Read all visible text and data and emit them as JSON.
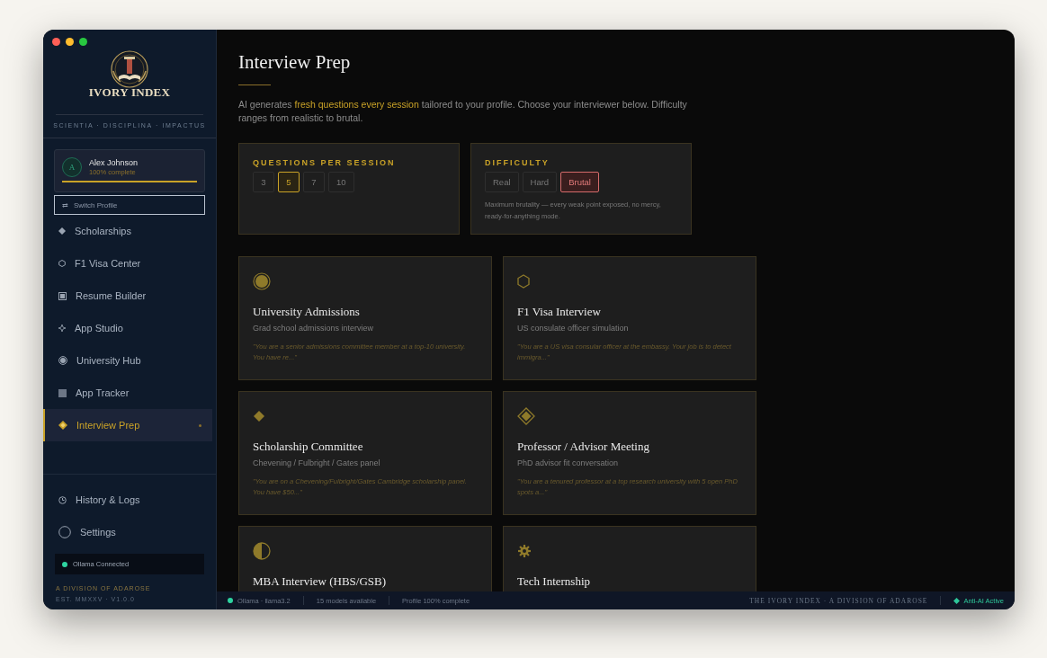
{
  "sidebar": {
    "logo_text": "IVORY INDEX",
    "motto": "SCIENTIA · DISCIPLINA · IMPACTUS",
    "profile": {
      "initial": "A",
      "name": "Alex Johnson",
      "progress_text": "100% complete",
      "level": 1
    },
    "switch_button": {
      "icon": "⇄",
      "label": "Switch Profile"
    },
    "nav_items": [
      {
        "label": "Scholarships",
        "selected": false
      },
      {
        "label": "F1 Visa Center",
        "selected": false
      },
      {
        "label": "Resume Builder",
        "selected": false
      },
      {
        "label": "App Studio",
        "selected": false
      },
      {
        "label": "University Hub",
        "selected": false
      },
      {
        "label": "App Tracker",
        "selected": false
      },
      {
        "label": "Interview Prep",
        "selected": true
      }
    ],
    "footer_items": [
      {
        "label": "History & Logs"
      },
      {
        "label": "Settings"
      }
    ],
    "connection": {
      "label": "Ollama Connected",
      "connected": true
    },
    "division": "A DIVISION OF ADAROSE",
    "version": "EST. MMXXV · V1.0.0"
  },
  "main": {
    "title": "Interview Prep",
    "intro": "AI generates **fresh questions every session** tailored to your profile. Choose your interviewer below. Difficulty ranges from realistic to brutal.",
    "questions": {
      "label": "QUESTIONS PER SESSION",
      "options": [
        {
          "label": "3",
          "selected": false
        },
        {
          "label": "5",
          "selected": true
        },
        {
          "label": "7",
          "selected": false
        },
        {
          "label": "10",
          "selected": false
        }
      ]
    },
    "difficulty": {
      "label": "DIFFICULTY",
      "options": [
        {
          "label": "Real",
          "selected": false
        },
        {
          "label": "Hard",
          "selected": false
        },
        {
          "label": "Brutal",
          "selected": true
        }
      ],
      "description": "Maximum brutality — every weak point exposed, no mercy, ready-for-anything mode."
    },
    "interviewers": [
      {
        "title": "University Admissions",
        "subtitle": "Grad school admissions interview",
        "prompt": "\"You are a senior admissions committee member at a top-10 university. You have re...\""
      },
      {
        "title": "F1 Visa Interview",
        "subtitle": "US consulate officer simulation",
        "prompt": "\"You are a US visa consular officer at the embassy. Your job is to detect immigra...\""
      },
      {
        "title": "Scholarship Committee",
        "subtitle": "Chevening / Fulbright / Gates panel",
        "prompt": "\"You are on a Chevening/Fulbright/Gates Cambridge scholarship panel. You have $50...\""
      },
      {
        "title": "Professor / Advisor Meeting",
        "subtitle": "PhD advisor fit conversation",
        "prompt": "\"You are a tenured professor at a top research university with 5 open PhD spots a...\""
      },
      {
        "title": "MBA Interview (HBS/GSB)"
      },
      {
        "title": "Tech Internship"
      }
    ]
  },
  "status_bar": {
    "model": "Ollama · llama3.2",
    "models": "15 models available",
    "profile": "Profile 100% complete",
    "brand": "THE IVORY INDEX · A DIVISION OF ADAROSE",
    "anti_ai": "Anti-AI Active"
  }
}
